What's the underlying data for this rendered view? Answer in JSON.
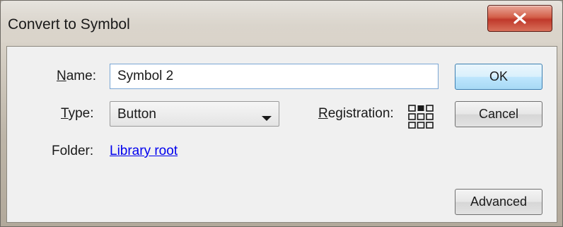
{
  "window": {
    "title": "Convert to Symbol"
  },
  "form": {
    "name_label": "Name:",
    "name_label_mnemonic": "N",
    "name_label_rest": "ame:",
    "name_value": "Symbol 2",
    "type_label_mnemonic": "T",
    "type_label_rest": "ype:",
    "type_value": "Button",
    "registration_mnemonic": "R",
    "registration_rest": "egistration:",
    "registration_selected": "top-center",
    "folder_label": "Folder:",
    "folder_link": "Library root"
  },
  "buttons": {
    "ok": "OK",
    "cancel": "Cancel",
    "advanced": "Advanced"
  },
  "icons": {
    "close": "close-icon",
    "dropdown": "chevron-down-icon",
    "registration": "registration-grid-icon"
  },
  "colors": {
    "close_button": "#c0392b",
    "link": "#0000ee",
    "input_border": "#7aa6d4"
  }
}
